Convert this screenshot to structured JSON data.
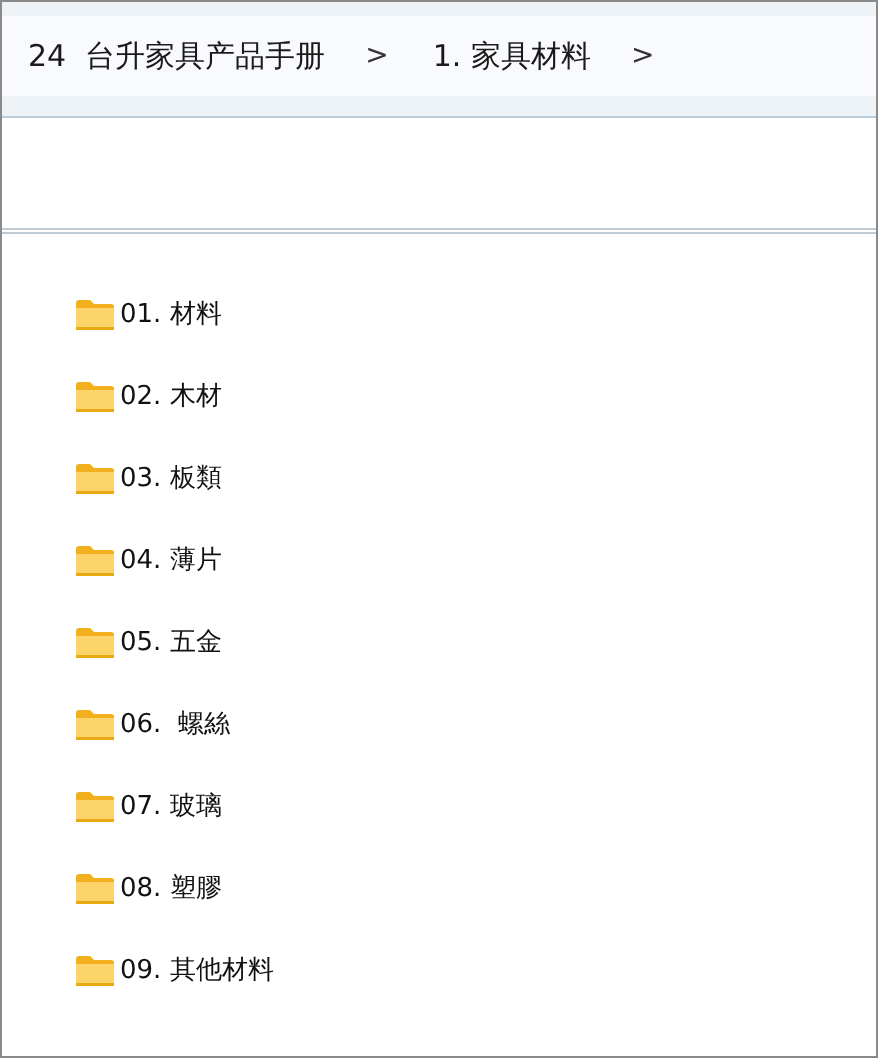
{
  "breadcrumb": [
    {
      "label": "24  台升家具产品手册"
    },
    {
      "label": "1. 家具材料"
    }
  ],
  "separator": ">",
  "folders": [
    {
      "name": "01. 材料"
    },
    {
      "name": "02. 木材"
    },
    {
      "name": "03. 板類"
    },
    {
      "name": "04. 薄片"
    },
    {
      "name": "05. 五金"
    },
    {
      "name": "06.  螺絲"
    },
    {
      "name": "07. 玻璃"
    },
    {
      "name": "08. 塑膠"
    },
    {
      "name": "09. 其他材料"
    }
  ]
}
